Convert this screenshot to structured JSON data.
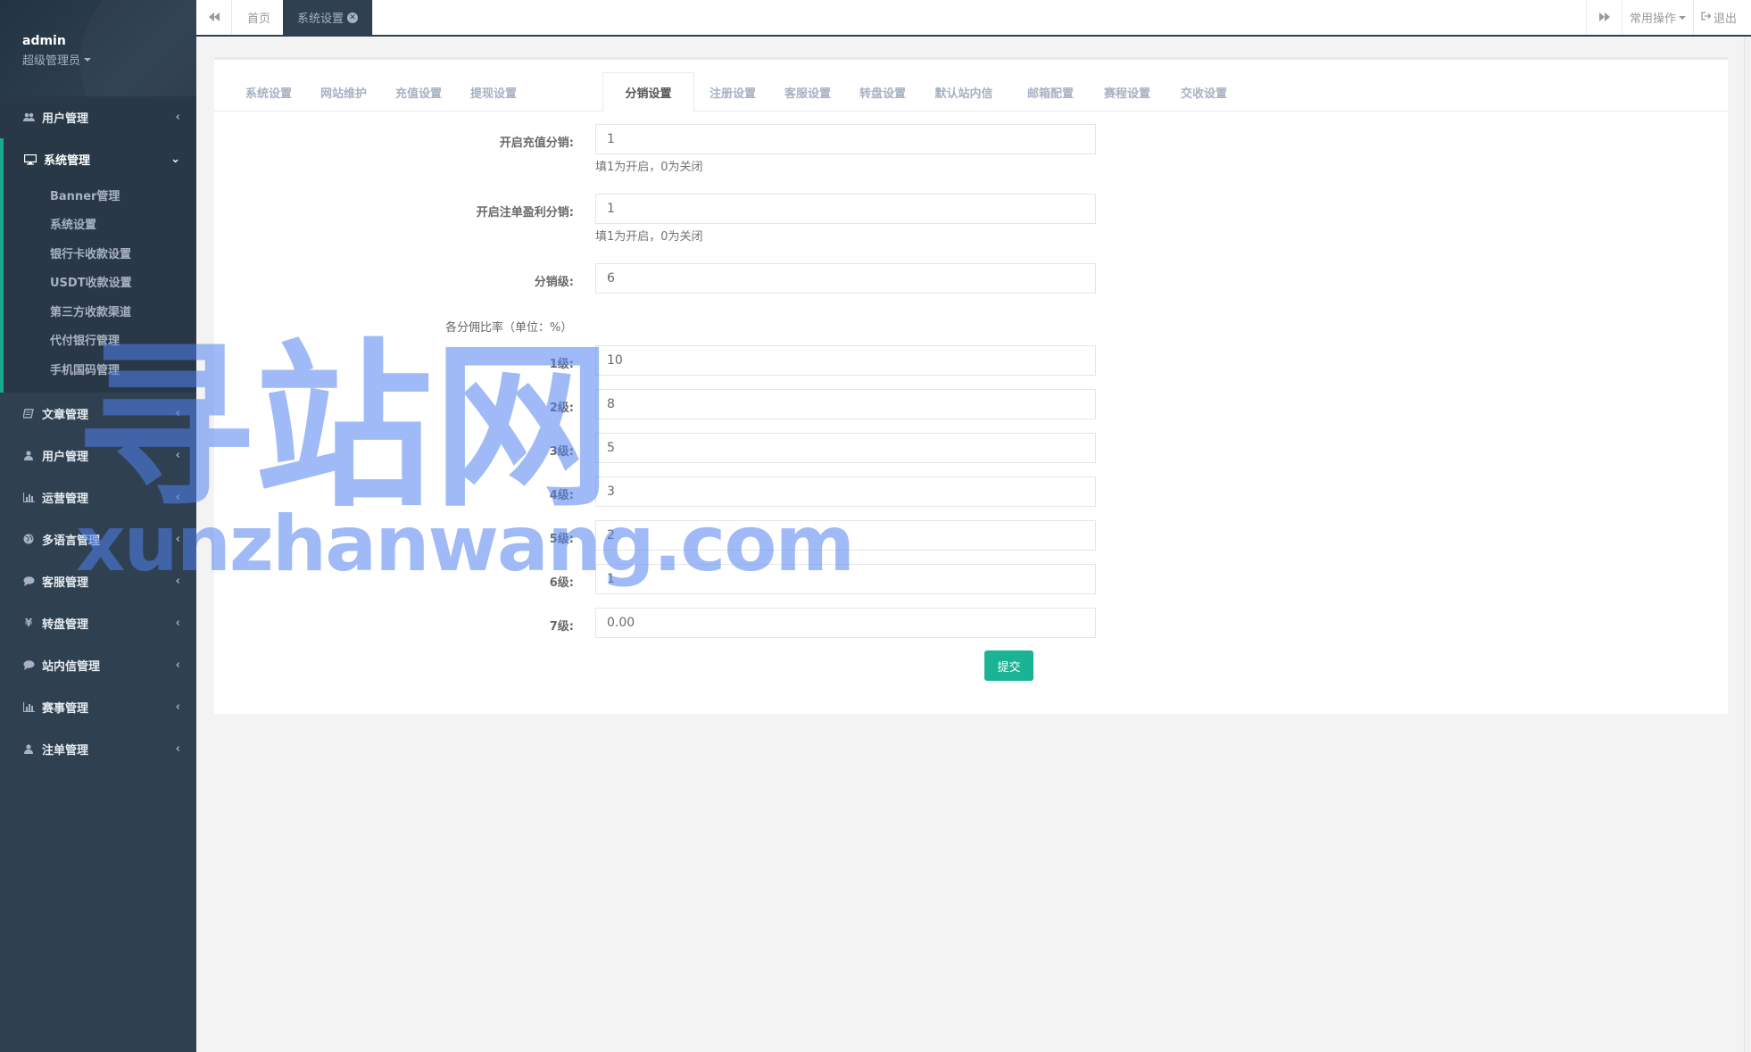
{
  "sidebar": {
    "profile": {
      "name": "admin",
      "role": "超级管理员"
    },
    "items": [
      {
        "label": "用户管理",
        "icon": "users-icon"
      },
      {
        "label": "系统管理",
        "icon": "desktop-icon",
        "expanded": true,
        "children": [
          "Banner管理",
          "系统设置",
          "银行卡收款设置",
          "USDT收款设置",
          "第三方收款渠道",
          "代付银行管理",
          "手机国码管理"
        ]
      },
      {
        "label": "文章管理",
        "icon": "book-icon"
      },
      {
        "label": "用户管理",
        "icon": "user-icon"
      },
      {
        "label": "运营管理",
        "icon": "bar-chart-icon"
      },
      {
        "label": "多语言管理",
        "icon": "globe-icon"
      },
      {
        "label": "客服管理",
        "icon": "comment-icon"
      },
      {
        "label": "转盘管理",
        "icon": "yen-icon"
      },
      {
        "label": "站内信管理",
        "icon": "comment-icon"
      },
      {
        "label": "赛事管理",
        "icon": "bar-chart-icon"
      },
      {
        "label": "注单管理",
        "icon": "user-icon"
      }
    ]
  },
  "topbar": {
    "tabs": [
      {
        "label": "首页",
        "active": false
      },
      {
        "label": "系统设置",
        "active": true
      }
    ],
    "common_ops": "常用操作",
    "logout": "退出"
  },
  "settings_tabs": [
    "系统设置",
    "网站维护",
    "充值设置",
    "提现设置",
    "分销设置",
    "注册设置",
    "客服设置",
    "转盘设置",
    "默认站内信",
    "邮箱配置",
    "赛程设置",
    "交收设置"
  ],
  "active_settings_tab": "分销设置",
  "form": {
    "recharge_distribution": {
      "label": "开启充值分销:",
      "value": "1",
      "help": "填1为开启，0为关闭"
    },
    "bet_profit_distribution": {
      "label": "开启注单盈利分销:",
      "value": "1",
      "help": "填1为开启，0为关闭"
    },
    "distribution_levels": {
      "label": "分销级:",
      "value": "6"
    },
    "rates_title": "各分佣比率（单位：%）",
    "rates": [
      {
        "label": "1级:",
        "value": "10"
      },
      {
        "label": "2级:",
        "value": "8"
      },
      {
        "label": "3级:",
        "value": "5"
      },
      {
        "label": "4级:",
        "value": "3"
      },
      {
        "label": "5级:",
        "value": "2"
      },
      {
        "label": "6级:",
        "value": "1"
      },
      {
        "label": "7级:",
        "value": "0.00"
      }
    ],
    "submit": "提交"
  },
  "watermark": {
    "cn": "寻站网",
    "en": "xunzhanwang.com"
  },
  "colors": {
    "sidebar_bg": "#2f4050",
    "accent": "#1ab394",
    "active_border": "#19aa8d"
  }
}
